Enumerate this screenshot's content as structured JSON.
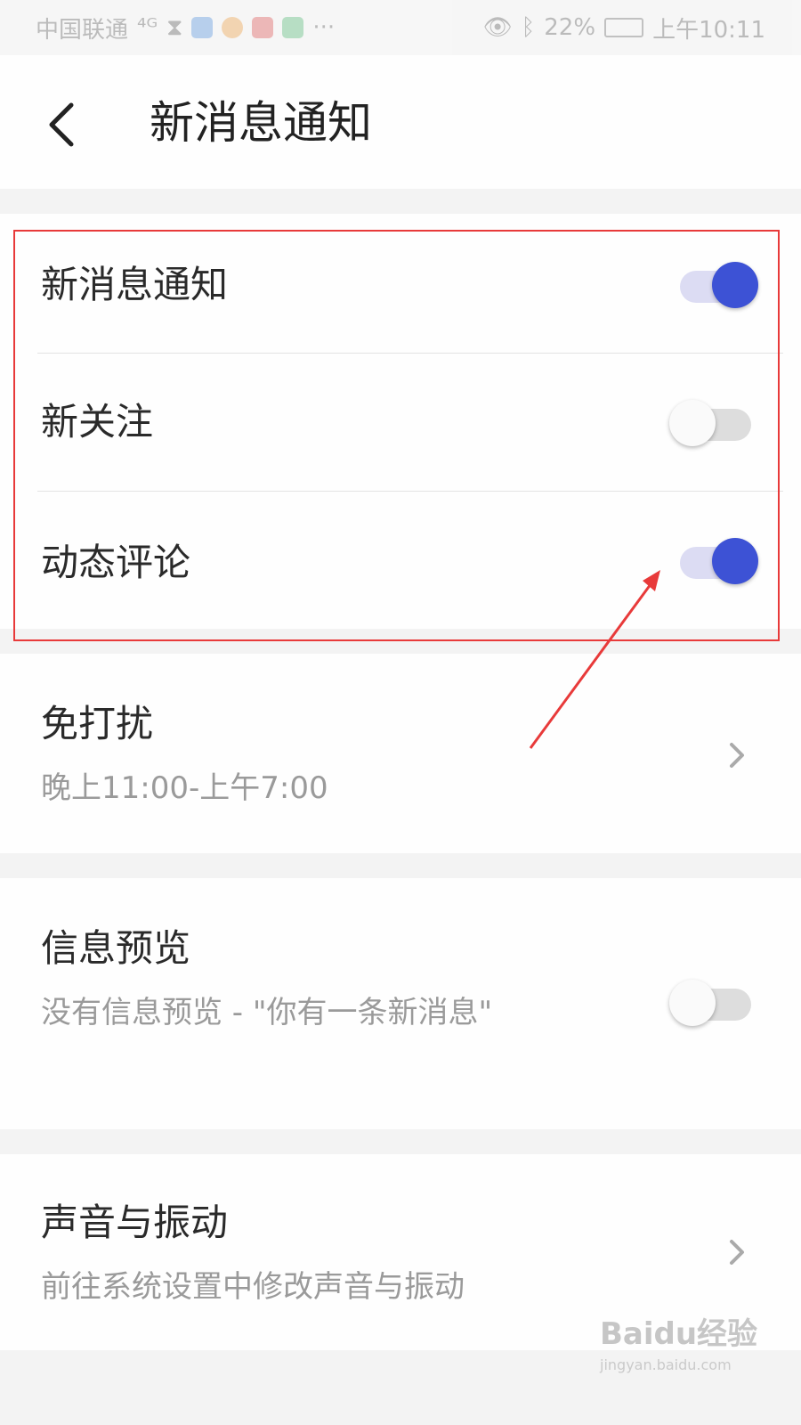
{
  "status_bar": {
    "carrier": "中国联通",
    "signal": "⁴ᴳ",
    "extra": "···",
    "battery_percent": "22%",
    "time": "上午10:11"
  },
  "header": {
    "title": "新消息通知"
  },
  "notification_settings": [
    {
      "label": "新消息通知",
      "enabled": true
    },
    {
      "label": "新关注",
      "enabled": false
    },
    {
      "label": "动态评论",
      "enabled": true
    }
  ],
  "do_not_disturb": {
    "title": "免打扰",
    "subtitle": "晚上11:00-上午7:00"
  },
  "message_preview": {
    "title": "信息预览",
    "subtitle": "没有信息预览 - \"你有一条新消息\"",
    "enabled": false
  },
  "sound_vibration": {
    "title": "声音与振动",
    "subtitle": "前往系统设置中修改声音与振动"
  },
  "watermark": {
    "brand": "Baidu经验",
    "url": "jingyan.baidu.com"
  },
  "colors": {
    "accent": "#3d52d5",
    "highlight": "#e83a3a"
  }
}
